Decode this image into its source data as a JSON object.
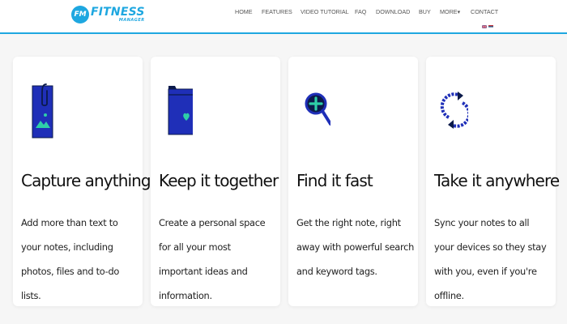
{
  "brand": {
    "badge": "FM",
    "name": "FITNESS",
    "subtitle": "MANAGER",
    "color": "#1ea7e0"
  },
  "nav": {
    "items": [
      {
        "label": "HOME"
      },
      {
        "label": "FEATURES"
      },
      {
        "label": "VIDEO TUTORIAL"
      },
      {
        "label": "FAQ"
      },
      {
        "label": "DOWNLOAD"
      },
      {
        "label": "BUY"
      },
      {
        "label": "MORE▾"
      },
      {
        "label": "CONTACT"
      }
    ],
    "flags": [
      "uk-flag-icon",
      "serbia-flag-icon"
    ]
  },
  "cards": [
    {
      "icon": "photo-note-icon",
      "title": "Capture anything",
      "text": "Add more than text to your notes, including photos, files and to-do lists."
    },
    {
      "icon": "folder-heart-icon",
      "title": "Keep it together",
      "text": "Create a personal space for all your most important ideas and information."
    },
    {
      "icon": "search-icon",
      "title": "Find it fast",
      "text": "Get the right note, right away with powerful search and keyword tags."
    },
    {
      "icon": "sync-icon",
      "title": "Take it anywhere",
      "text": "Sync your notes to all your devices so they stay with you, even if you're offline."
    }
  ],
  "colors": {
    "icon_primary": "#1f2fb8",
    "icon_accent": "#2ecfa8",
    "icon_dark": "#0b1a4a"
  }
}
